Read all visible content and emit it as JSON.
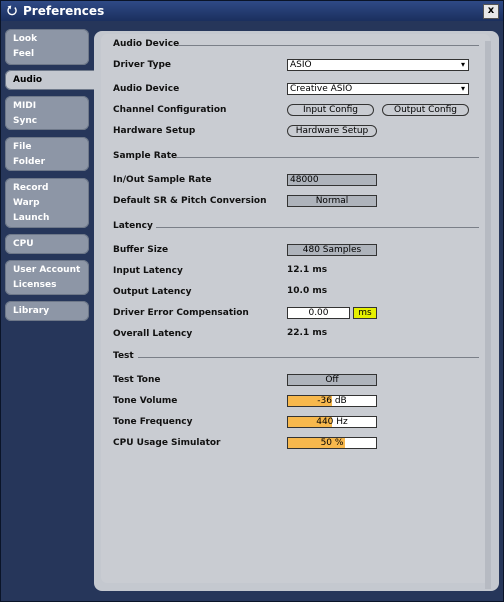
{
  "window": {
    "title": "Preferences",
    "close_label": "x"
  },
  "sidebar": {
    "tabs": [
      {
        "line1": "Look",
        "line2": "Feel"
      },
      {
        "line1": "Audio"
      },
      {
        "line1": "MIDI",
        "line2": "Sync"
      },
      {
        "line1": "File",
        "line2": "Folder"
      },
      {
        "line1": "Record",
        "line2": "Warp",
        "line3": "Launch"
      },
      {
        "line1": "CPU"
      },
      {
        "line1": "User Account",
        "line2": "Licenses"
      },
      {
        "line1": "Library"
      }
    ],
    "active": "Audio"
  },
  "audio_device": {
    "heading": "Audio Device",
    "driver_type_label": "Driver Type",
    "driver_type_value": "ASIO",
    "audio_device_label": "Audio Device",
    "audio_device_value": "Creative ASIO",
    "channel_config_label": "Channel Configuration",
    "input_config_button": "Input Config",
    "output_config_button": "Output Config",
    "hardware_setup_label": "Hardware Setup",
    "hardware_setup_button": "Hardware Setup"
  },
  "sample_rate": {
    "heading": "Sample Rate",
    "in_out_label": "In/Out Sample Rate",
    "in_out_value": "48000",
    "default_sr_label": "Default SR & Pitch Conversion",
    "default_sr_value": "Normal"
  },
  "latency": {
    "heading": "Latency",
    "buffer_size_label": "Buffer Size",
    "buffer_size_value": "480 Samples",
    "input_latency_label": "Input Latency",
    "input_latency_value": "12.1 ms",
    "output_latency_label": "Output Latency",
    "output_latency_value": "10.0 ms",
    "driver_error_label": "Driver Error Compensation",
    "driver_error_value": "0.00",
    "driver_error_unit": "ms",
    "overall_latency_label": "Overall Latency",
    "overall_latency_value": "22.1 ms"
  },
  "test": {
    "heading": "Test",
    "test_tone_label": "Test Tone",
    "test_tone_value": "Off",
    "tone_volume_label": "Tone Volume",
    "tone_volume_value": "-36 dB",
    "tone_volume_level": 0.5,
    "tone_frequency_label": "Tone Frequency",
    "tone_frequency_value": "440 Hz",
    "tone_frequency_level": 0.5,
    "cpu_sim_label": "CPU Usage Simulator",
    "cpu_sim_value": "50 %",
    "cpu_sim_level": 0.65
  },
  "colors": {
    "accent_slider": "#f7b84d",
    "unit_highlight": "#e6f000"
  }
}
